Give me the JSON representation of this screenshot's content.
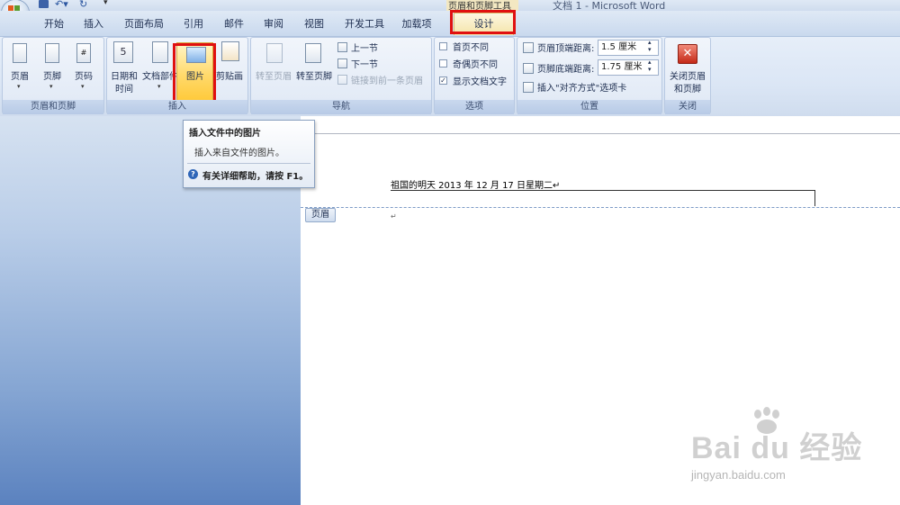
{
  "window": {
    "title": "文档 1 - Microsoft Word"
  },
  "context_tab_group": {
    "label": "页眉和页脚工具"
  },
  "tabs": [
    {
      "label": "开始"
    },
    {
      "label": "插入"
    },
    {
      "label": "页面布局"
    },
    {
      "label": "引用"
    },
    {
      "label": "邮件"
    },
    {
      "label": "审阅"
    },
    {
      "label": "视图"
    },
    {
      "label": "开发工具"
    },
    {
      "label": "加载项"
    },
    {
      "label": "设计"
    }
  ],
  "ribbon": {
    "header_footer": {
      "label": "页眉和页脚",
      "header": "页眉",
      "footer": "页脚",
      "page_number": "页码"
    },
    "insert": {
      "label": "插入",
      "datetime_line1": "日期和",
      "datetime_line2": "时间",
      "quickparts": "文档部件",
      "picture": "图片",
      "clipart": "剪贴画"
    },
    "navigation": {
      "label": "导航",
      "goto_header": "转至页眉",
      "goto_footer": "转至页脚",
      "previous": "上一节",
      "next": "下一节",
      "link_previous": "链接到前一条页眉"
    },
    "options": {
      "label": "选项",
      "diff_first": "首页不同",
      "diff_odd_even": "奇偶页不同",
      "show_doc_text": "显示文档文字",
      "diff_first_checked": false,
      "diff_odd_even_checked": false,
      "show_doc_text_checked": true
    },
    "position": {
      "label": "位置",
      "header_from_top_label": "页眉顶端距离:",
      "header_from_top_value": "1.5 厘米",
      "footer_from_bottom_label": "页脚底端距离:",
      "footer_from_bottom_value": "1.75 厘米",
      "insert_align_tab": "插入\"对齐方式\"选项卡"
    },
    "close": {
      "label": "关闭",
      "close_line1": "关闭页眉",
      "close_line2": "和页脚"
    }
  },
  "tooltip": {
    "title": "插入文件中的图片",
    "description": "插入来自文件的图片。",
    "help": "有关详细帮助，请按 F1。"
  },
  "document": {
    "header_text": "祖国的明天   2013 年 12 月 17 日星期二↵",
    "header_tag": "页眉",
    "paragraph_mark": "↵"
  },
  "watermark": {
    "logo": "Bai du 经验",
    "url": "jingyan.baidu.com"
  },
  "colors": {
    "highlight_box": "#e01010",
    "ribbon_bg": "#dbe6f5",
    "workspace_bg": "#86a6d3"
  }
}
